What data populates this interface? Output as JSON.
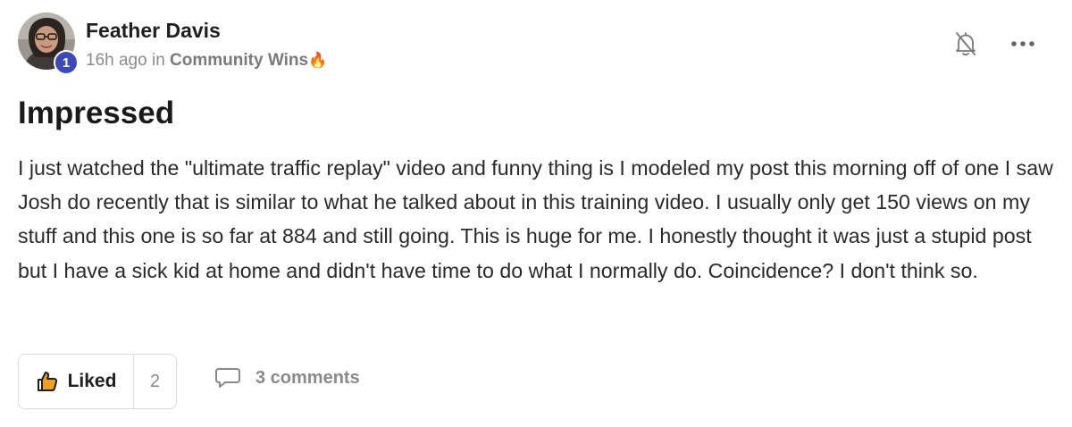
{
  "post": {
    "author": {
      "name": "Feather Davis",
      "level": "1",
      "avatar_icon": "user-avatar-photo"
    },
    "meta": {
      "time": "16h ago",
      "in_word": "in",
      "category": "Community Wins",
      "category_emoji": "🔥"
    },
    "title": "Impressed",
    "body": "I just watched the \"ultimate traffic replay\" video and funny thing is I modeled my post this morning off of one I saw Josh do recently that is similar to what he talked about in this training video. I usually only get 150 views on my stuff and this one is so far at 884 and still going. This is huge for me. I honestly thought it was just a stupid post but I have a sick kid at home and didn't have time to do what I normally do. Coincidence? I don't think so.",
    "actions": {
      "like_label": "Liked",
      "like_count": "2",
      "comments_label": "3 comments"
    },
    "icons": {
      "notification": "bell-off-icon",
      "more": "more-horizontal-icon",
      "like": "thumbs-up-icon",
      "comment": "comment-bubble-icon"
    },
    "colors": {
      "badge": "#3b4ab8",
      "like_icon": "#f0a020",
      "muted_text": "#8a8a8a"
    }
  }
}
